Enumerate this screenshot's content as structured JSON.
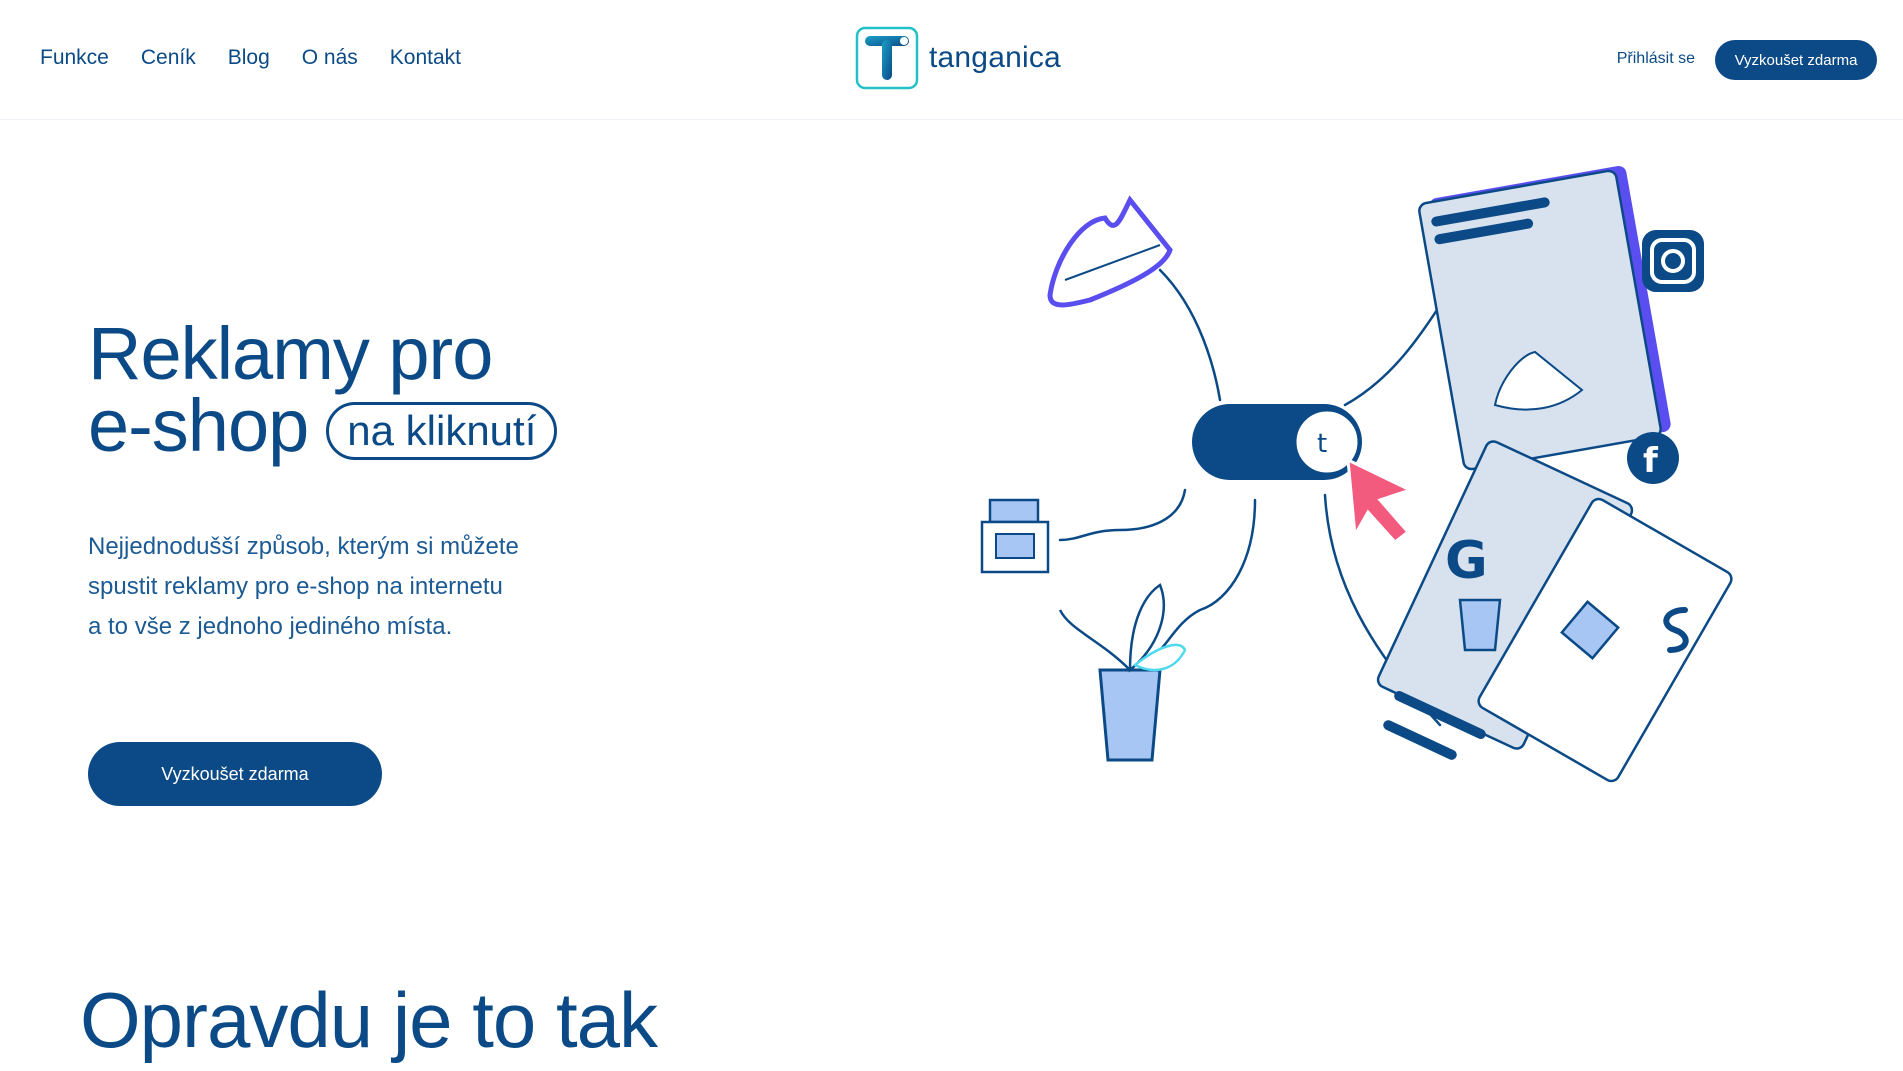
{
  "nav": {
    "items": [
      {
        "label": "Funkce"
      },
      {
        "label": "Ceník"
      },
      {
        "label": "Blog"
      },
      {
        "label": "O nás"
      },
      {
        "label": "Kontakt"
      }
    ]
  },
  "logo": {
    "text": "tanganica"
  },
  "header": {
    "login_label": "Přihlásit se",
    "cta_label": "Vyzkoušet zdarma"
  },
  "hero": {
    "title_line1": "Reklamy pro",
    "title_line2": "e-shop",
    "title_pill": "na kliknutí",
    "subtitle_line1": "Nejjednodušší způsob, kterým si můžete",
    "subtitle_line2": "spustit reklamy pro e-shop na internetu",
    "subtitle_line3": "a to vše z jednoho jediného místa.",
    "cta_label": "Vyzkoušet zdarma"
  },
  "section2": {
    "title": "Opravdu je to tak"
  },
  "colors": {
    "primary": "#0b4a86",
    "accent_purple": "#5b4ef0",
    "accent_pink": "#f25a7e",
    "light_blue": "#a7c6f3",
    "cyan": "#4fd8f0"
  }
}
